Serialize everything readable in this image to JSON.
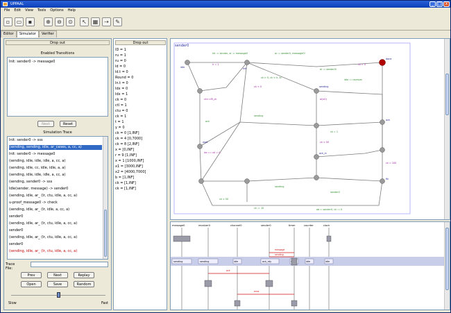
{
  "window": {
    "title": "UPPAAL",
    "minimize": "_",
    "maximize": "□",
    "close": "x"
  },
  "menu": [
    "File",
    "Edit",
    "View",
    "Tools",
    "Options",
    "Help"
  ],
  "toolbar_icons": [
    "new-icon",
    "open-icon",
    "save-icon",
    "zoom-in-icon",
    "zoom-out-icon",
    "zoom-fit-icon",
    "select-icon",
    "grid-icon",
    "trace-icon",
    "edit-icon"
  ],
  "tabs": [
    "Editor",
    "Simulator",
    "Verifier"
  ],
  "left": {
    "dropdown": "Drop out",
    "enabled_label": "Enabled Transitions",
    "enabled_items": [
      "Init: sender0 -> message0"
    ],
    "next_button": "Next",
    "reset_button": "Reset",
    "trace_label": "Simulation Trace",
    "trace_items": [
      "Init: sender0 -> sss",
      "(sending, sending, idle, ar_cases, a, cc, a)",
      "Init: sender0 -> message0",
      "(sending, idle, idle, idle, a, cc, a)",
      "(sending, idle, cc, idle, idle, a, a)",
      "(sending, idle, idle, idle, a, cc, a)",
      "(sending, sender0 -> sss",
      "Idle(sender, message) -> sender0",
      "(sending, idle, ar_ (Ir, ctu, idle, a, cc, a)",
      "u-proof_message0 -> check",
      "(sending, idle, ar_ (Ir, idle, a, cc, a)",
      "sender0",
      "(sending, idle, ar_ (Ir, ctu, idle, a, cc, a)",
      "sender0",
      "(sending, idle, ar_ (Ir, ctu, idle, a, cc, a)",
      "sender0",
      "(sending, idle, ar_ (Ir, ctu, idle, a, cc, a)"
    ],
    "selected_index": 1,
    "red_index": 16,
    "tracefile_label": "Trace File:",
    "buttons": [
      "Prev",
      "Next",
      "Replay",
      "Open",
      "Save",
      "Random"
    ],
    "slow_label": "Slow",
    "fast_label": "Fast"
  },
  "variables": {
    "dropdown": "Drop out",
    "items": [
      "ID = 1",
      "ru = 1",
      "ru = 0",
      "ld = 0",
      "ld.t = 0",
      "Round = 0",
      "ln.t = 0",
      "Idx = 0",
      "Idx = 1",
      "ck = 0",
      "ctl = 1",
      "ctu = 0",
      "ck = 1",
      "t = 1",
      "y = 0",
      "ck = 0 [1,INF]",
      "ck = 4 [0,7000]",
      "ck = 8 [2,INF]",
      "x = [0,INF]",
      "r = 9 [1,INF]",
      "x = 1 [1000,INF]",
      "x1 = [3000,INF]",
      "x2 = [4000,7000]",
      "b = [1,INF]",
      "ck = [1,INF]",
      "ck = [1,INF]"
    ]
  },
  "automaton": {
    "name": "sender0",
    "edges_top": [
      "Int := sender, ai := message0",
      "ai := sender0, message0!",
      "ai := sender0!",
      "idle := receiver",
      "Ir = 1",
      "ck = 0"
    ],
    "guards": [
      "ck>=IR_ck",
      "ck < 0",
      "ai(x0)",
      "ck < 50",
      "lm:== x0 = 0,",
      "ck = 100"
    ],
    "edges_mid": [
      "ck > 0, ck < Ir, ai",
      "ack",
      "sending",
      "ck = 1"
    ],
    "edges_bottom": [
      "ck < 50",
      "ck := 10",
      "sending",
      "sender0",
      "ab = sender0, ck := 0"
    ],
    "state_labels": [
      "idle",
      "init",
      "done",
      "sending",
      "wait",
      "ack_in",
      "ack",
      "fin"
    ]
  },
  "msc": {
    "headers": [
      "message0",
      "receiver0",
      "channel0",
      "sender0",
      "timer",
      "counter",
      "clock"
    ],
    "band_labels": [
      "sending",
      "sending",
      "idle",
      "ack_rdy",
      "idle",
      "idle",
      "idle"
    ],
    "msgs": [
      "message",
      "sending",
      "ack",
      "error"
    ]
  }
}
